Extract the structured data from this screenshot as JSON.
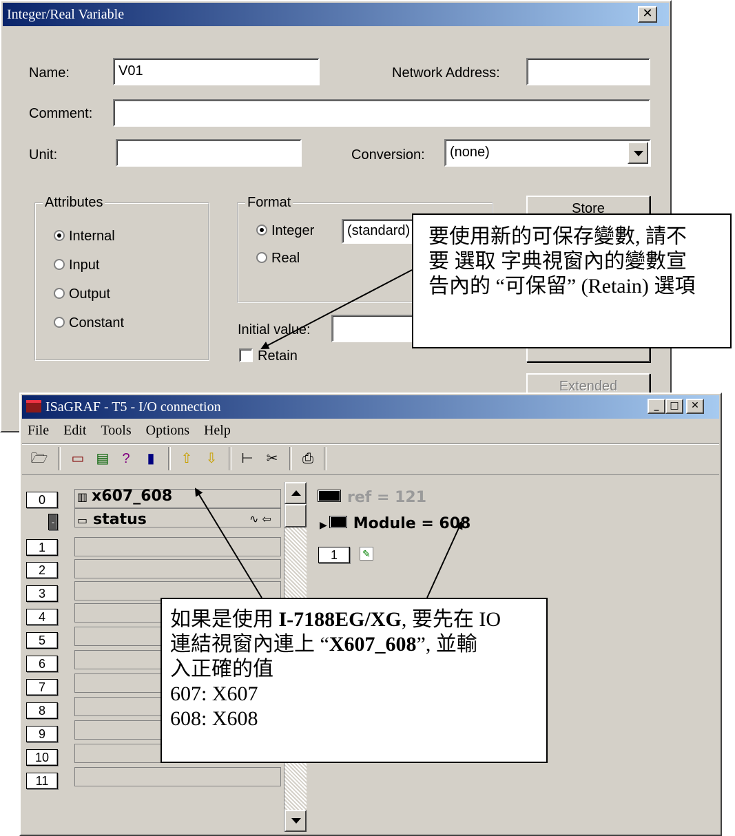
{
  "dialog": {
    "title": "Integer/Real Variable",
    "close_glyph": "✕",
    "name_label": "Name:",
    "name_value": "V01",
    "network_address_label": "Network Address:",
    "network_address_value": "",
    "comment_label": "Comment:",
    "comment_value": "",
    "unit_label": "Unit:",
    "unit_value": "",
    "conversion_label": "Conversion:",
    "conversion_value": "(none)",
    "attributes": {
      "title": "Attributes",
      "options": [
        {
          "label": "Internal",
          "selected": true
        },
        {
          "label": "Input",
          "selected": false
        },
        {
          "label": "Output",
          "selected": false
        },
        {
          "label": "Constant",
          "selected": false
        }
      ]
    },
    "format": {
      "title": "Format",
      "integer_label": "Integer",
      "real_label": "Real",
      "format_value": "(standard)"
    },
    "initial_value_label": "Initial value:",
    "retain_label": "Retain",
    "retain_checked": false,
    "store_button": "Store",
    "extended_button": "Extended"
  },
  "io_window": {
    "title": "ISaGRAF - T5 - I/O connection",
    "menu": [
      "File",
      "Edit",
      "Tools",
      "Options",
      "Help"
    ],
    "toolbar_icons": [
      "open-icon",
      "board-icon",
      "properties-icon",
      "info-icon",
      "delete-icon",
      "move-up-icon",
      "move-down-icon",
      "tree-icon",
      "cut-icon",
      "print-icon"
    ],
    "slots": [
      {
        "num": "0",
        "text": "x607_608"
      },
      {
        "num": "-",
        "text": "status"
      },
      {
        "num": "1",
        "text": ""
      },
      {
        "num": "2",
        "text": ""
      },
      {
        "num": "3",
        "text": ""
      },
      {
        "num": "4",
        "text": ""
      },
      {
        "num": "5",
        "text": ""
      },
      {
        "num": "6",
        "text": ""
      },
      {
        "num": "7",
        "text": ""
      },
      {
        "num": "8",
        "text": ""
      },
      {
        "num": "9",
        "text": ""
      },
      {
        "num": "10",
        "text": ""
      },
      {
        "num": "11",
        "text": ""
      }
    ],
    "ref_text": "ref = 121",
    "module_text": "Module = 608",
    "param_num": "1"
  },
  "callouts": {
    "retain_note": [
      "要使用新的可保存變數, 請不",
      "要  選取  字典視窗內的變數宣",
      "告內的 “可保留” (Retain)  選項"
    ],
    "io_note": {
      "line1_a": "如果是使用 ",
      "line1_b": "I-7188EG/XG",
      "line1_c": ", 要先在 IO",
      "line2_a": "連結視窗內連上 “",
      "line2_b": "X607_608",
      "line2_c": "”, 並輸",
      "line3": "入正確的值",
      "line4": "607: X607",
      "line5": "608: X608"
    }
  }
}
